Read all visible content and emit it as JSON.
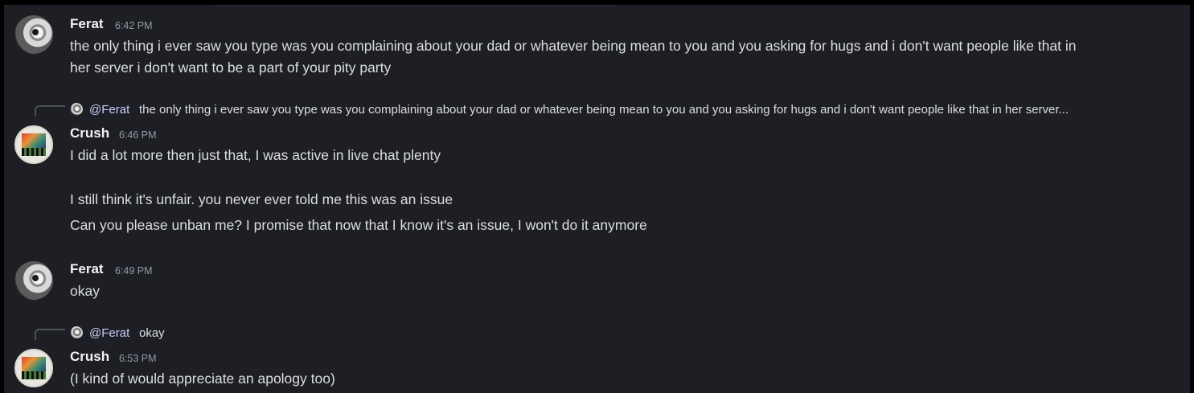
{
  "messages": [
    {
      "author": "Ferat",
      "time": "6:42 PM",
      "avatar": "ferat-avatar",
      "lines": [
        "the only thing i ever saw you type was you complaining about your dad or whatever being mean to you and you asking for hugs and i don't want people like that in",
        "her server i don't want to be a part of your pity party"
      ]
    },
    {
      "reply": {
        "mention": "@Ferat",
        "text": "the only thing i ever saw you type was you complaining about your dad or whatever being mean to you and you asking for hugs and i don't want people like that in her server..."
      },
      "author": "Crush",
      "time": "6:46 PM",
      "avatar": "crush-avatar",
      "lines": [
        "I did a lot more then just that, I was active in live chat plenty",
        "I still think it's unfair. you never ever told me this was an issue",
        "Can you please unban me? I promise that now that I know it's an issue, I won't do it anymore"
      ]
    },
    {
      "author": "Ferat",
      "time": "6:49 PM",
      "avatar": "ferat-avatar",
      "lines": [
        "okay"
      ]
    },
    {
      "reply": {
        "mention": "@Ferat",
        "text": "okay"
      },
      "author": "Crush",
      "time": "6:53 PM",
      "avatar": "crush-avatar",
      "lines": [
        "(I kind of would appreciate an apology too)"
      ]
    }
  ],
  "colors": {
    "background": "#1e1f24",
    "author": "#f2f3f5",
    "timestamp": "#949ba4",
    "text": "#dbdee1",
    "mention": "#c9cdfb"
  }
}
